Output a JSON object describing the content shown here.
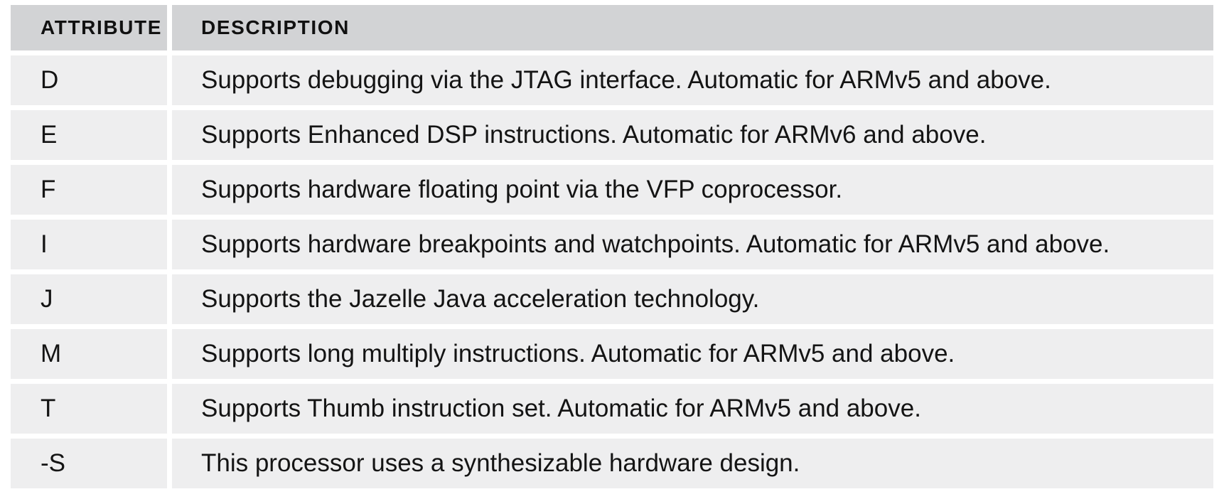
{
  "table": {
    "headers": [
      "ATTRIBUTE",
      "DESCRIPTION"
    ],
    "rows": [
      {
        "attribute": "D",
        "description": "Supports debugging via the JTAG interface. Automatic for ARMv5 and above."
      },
      {
        "attribute": "E",
        "description": "Supports Enhanced DSP instructions. Automatic for ARMv6 and above."
      },
      {
        "attribute": "F",
        "description": "Supports hardware floating point via the VFP coprocessor."
      },
      {
        "attribute": "I",
        "description": "Supports hardware breakpoints and watchpoints. Automatic for ARMv5 and above."
      },
      {
        "attribute": "J",
        "description": "Supports the Jazelle Java acceleration technology."
      },
      {
        "attribute": "M",
        "description": "Supports long multiply instructions. Automatic for ARMv5 and above."
      },
      {
        "attribute": "T",
        "description": "Supports Thumb instruction set. Automatic for ARMv5 and above."
      },
      {
        "attribute": "-S",
        "description": "This processor uses a synthesizable hardware design."
      }
    ]
  }
}
